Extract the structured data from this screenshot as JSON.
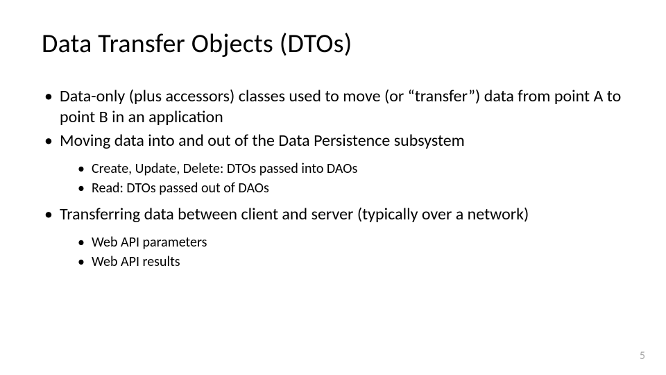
{
  "title": "Data Transfer Objects (DTOs)",
  "bullets": {
    "b1": "Data-only (plus accessors) classes used to move (or “transfer”) data from point A to point B in an application",
    "b2": "Moving data into and out of the Data Persistence subsystem",
    "b2a": "Create, Update, Delete: DTOs passed into DAOs",
    "b2b": "Read: DTOs passed out of DAOs",
    "b3": "Transferring data between client and server (typically over a network)",
    "b3a": "Web API parameters",
    "b3b": "Web API results"
  },
  "pagenum": "5"
}
